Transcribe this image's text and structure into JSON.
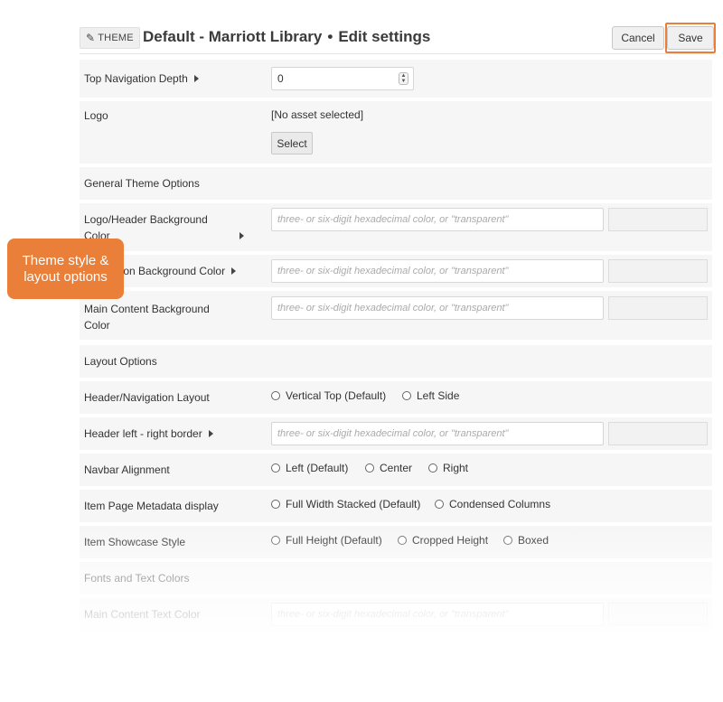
{
  "header": {
    "theme_chip": "THEME",
    "title": "Default - Marriott Library",
    "separator": "•",
    "subtitle": "Edit settings",
    "cancel_label": "Cancel",
    "save_label": "Save"
  },
  "rows": {
    "top_nav_depth": {
      "label": "Top Navigation Depth",
      "value": "0"
    },
    "logo": {
      "label": "Logo",
      "value": "[No asset selected]",
      "button": "Select"
    },
    "general_section": {
      "label": "General Theme Options"
    },
    "logo_header_bg": {
      "label": "Logo/Header Background Color",
      "placeholder": "three- or six-digit hexadecimal color, or \"transparent\""
    },
    "navigation_bg": {
      "label": "Navigation Background Color",
      "placeholder": "three- or six-digit hexadecimal color, or \"transparent\""
    },
    "main_content_bg": {
      "label": "Main Content Background Color",
      "placeholder": "three- or six-digit hexadecimal color, or \"transparent\""
    },
    "layout_section": {
      "label": "Layout Options"
    },
    "header_nav_layout": {
      "label": "Header/Navigation Layout",
      "options": [
        "Vertical Top (Default)",
        "Left Side"
      ]
    },
    "header_border": {
      "label": "Header left - right border",
      "placeholder": "three- or six-digit hexadecimal color, or \"transparent\""
    },
    "navbar_alignment": {
      "label": "Navbar Alignment",
      "options": [
        "Left (Default)",
        "Center",
        "Right"
      ]
    },
    "item_metadata": {
      "label": "Item Page Metadata display",
      "options": [
        "Full Width Stacked (Default)",
        "Condensed Columns"
      ]
    },
    "item_showcase": {
      "label": "Item Showcase Style",
      "options": [
        "Full Height (Default)",
        "Cropped Height",
        "Boxed"
      ]
    },
    "fonts_section": {
      "label": "Fonts and Text Colors"
    },
    "main_text_color": {
      "label": "Main Content Text Color",
      "placeholder": "three- or six-digit hexadecimal color, or \"transparent\""
    }
  },
  "callout": {
    "text": "Theme style & layout options"
  },
  "colors": {
    "accent": "#ea7f3a",
    "row_bg": "#f6f6f6"
  }
}
